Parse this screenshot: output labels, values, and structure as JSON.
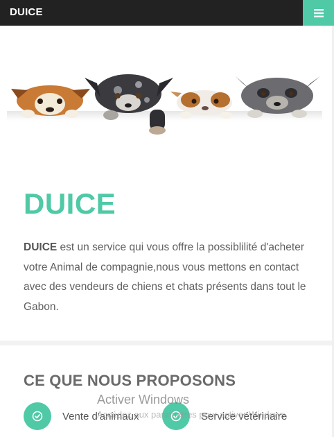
{
  "navbar": {
    "brand": "DUICE",
    "menu_icon": "hamburger-icon",
    "accent_color": "#4fc9a6",
    "background": "#222222"
  },
  "hero": {
    "image": "peeking-dogs-illustration"
  },
  "about": {
    "title": "DUICE",
    "brand_bold": "DUICE",
    "text": " est un service qui vous offre la possiblilité d'acheter votre Animal de compagnie,nous vous mettons en contact avec des vendeurs de chiens et chats présents dans tout le Gabon."
  },
  "services": {
    "title": "CE QUE NOUS PROPOSONS",
    "items": [
      {
        "label": "Vente d'animaux",
        "icon": "check-icon"
      },
      {
        "label": "Service vétérinaire",
        "icon": "check-icon"
      }
    ]
  },
  "watermark": {
    "title": "Activer Windows",
    "subtitle": "Accédez aux paramètres pour activer Windows."
  }
}
